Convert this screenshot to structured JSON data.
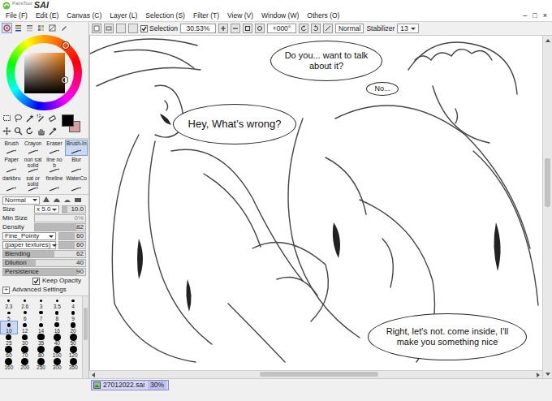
{
  "app": {
    "brand": "PaintTool",
    "name": "SAI"
  },
  "window_controls": [
    "–",
    "□",
    "×"
  ],
  "menu": [
    "File (F)",
    "Edit (E)",
    "Canvas (C)",
    "Layer (L)",
    "Selection (S)",
    "Filter (T)",
    "View (V)",
    "Window (W)",
    "Others (O)"
  ],
  "color_modes": [
    {
      "selected": true
    },
    {
      "selected": false
    },
    {
      "selected": false
    },
    {
      "selected": false
    },
    {
      "selected": false
    },
    {
      "selected": false
    }
  ],
  "color": {
    "hue": "#e8780c",
    "primary": "#000000",
    "secondary": "#d9a0a0"
  },
  "toolbar": {
    "selection": {
      "label": "Selection",
      "checked": true
    },
    "zoom": "30.53%",
    "rotation": "+000°",
    "blend_mode": "Normal",
    "stabilizer_label": "Stabilizer",
    "stabilizer": "13"
  },
  "tools": [
    {
      "label": "Brush",
      "selected": false
    },
    {
      "label": "Crayon",
      "selected": false
    },
    {
      "label": "Eraser",
      "selected": false
    },
    {
      "label": "Brush-In",
      "selected": true
    },
    {
      "label": "Paper",
      "selected": false
    },
    {
      "label": "non sat solid",
      "selected": false
    },
    {
      "label": "line no b",
      "selected": false
    },
    {
      "label": "Blur",
      "selected": false
    },
    {
      "label": "darkbru",
      "selected": false
    },
    {
      "label": "sat or solid",
      "selected": false
    },
    {
      "label": "fineline",
      "selected": false
    },
    {
      "label": "WaterCo",
      "selected": false
    }
  ],
  "brush": {
    "mode": "Normal",
    "size": {
      "label": "Size",
      "multiplier": "x 5.0",
      "value": "10.0",
      "level": 0.2
    },
    "sliders": [
      {
        "label": "Min Size",
        "value": "0%",
        "level": 0,
        "disabled": true
      },
      {
        "label": "Density",
        "value": "82",
        "level": 0.82,
        "disabled": false
      }
    ],
    "shape": {
      "name": "Fine_Pointy",
      "value": "60",
      "level": 0.6
    },
    "texture": {
      "name": "(paper textures)",
      "value": "60",
      "level": 0.6
    },
    "mix": [
      {
        "label": "Blending",
        "value": "62",
        "level": 0.62
      },
      {
        "label": "Dilution",
        "value": "40",
        "level": 0.4
      },
      {
        "label": "Persistence",
        "value": "90",
        "level": 0.9
      }
    ],
    "keep_opacity": {
      "label": "Keep Opacity",
      "checked": true
    },
    "advanced": {
      "icon": "+",
      "label": "Advanced Settings"
    }
  },
  "brush_sizes": [
    {
      "label": "2.3",
      "selected": false
    },
    {
      "label": "2.6",
      "selected": false
    },
    {
      "label": "3",
      "selected": false
    },
    {
      "label": "3.5",
      "selected": false
    },
    {
      "label": "4",
      "selected": false
    },
    {
      "label": "5",
      "selected": false
    },
    {
      "label": "6",
      "selected": false
    },
    {
      "label": "7",
      "selected": false
    },
    {
      "label": "8",
      "selected": false
    },
    {
      "label": "9",
      "selected": false
    },
    {
      "label": "10",
      "selected": true
    },
    {
      "label": "12",
      "selected": false
    },
    {
      "label": "14",
      "selected": false
    },
    {
      "label": "16",
      "selected": false
    },
    {
      "label": "20",
      "selected": false
    },
    {
      "label": "25",
      "selected": false
    },
    {
      "label": "30",
      "selected": false
    },
    {
      "label": "35",
      "selected": false
    },
    {
      "label": "40",
      "selected": false
    },
    {
      "label": "50",
      "selected": false
    },
    {
      "label": "60",
      "selected": false
    },
    {
      "label": "70",
      "selected": false
    },
    {
      "label": "80",
      "selected": false
    },
    {
      "label": "100",
      "selected": false
    },
    {
      "label": "120",
      "selected": false
    },
    {
      "label": "160",
      "selected": false
    },
    {
      "label": "200",
      "selected": false
    },
    {
      "label": "250",
      "selected": false
    },
    {
      "label": "300",
      "selected": false
    },
    {
      "label": "350",
      "selected": false
    }
  ],
  "canvas": {
    "bubbles": [
      {
        "text": "Do you... want to talk about it?"
      },
      {
        "text": "No..."
      },
      {
        "text": "Hey, What's wrong?"
      },
      {
        "text": "Right, let's not. come inside, I'll make you something nice"
      }
    ]
  },
  "document_tabs": [
    {
      "name": "27012022.sai",
      "zoom": "30%",
      "selected": true
    }
  ]
}
